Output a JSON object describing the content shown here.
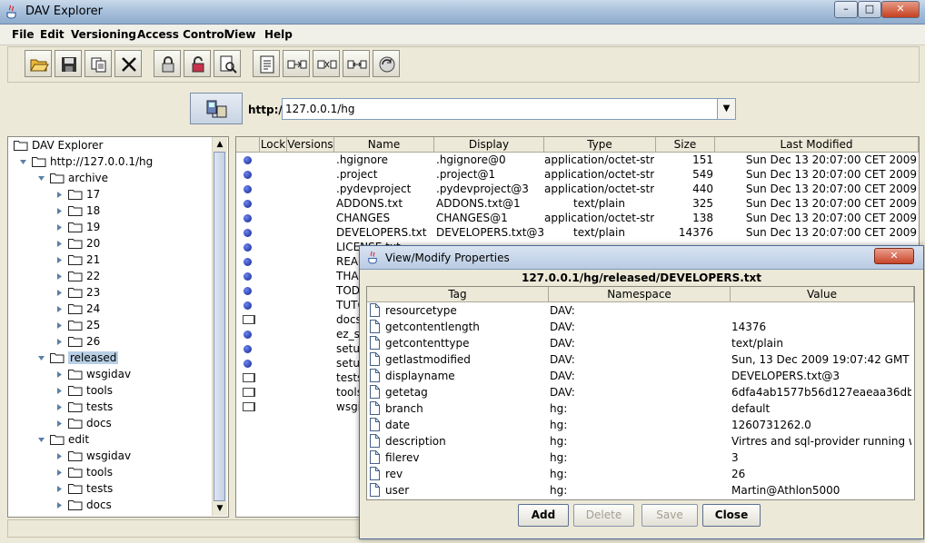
{
  "window": {
    "title": "DAV Explorer",
    "minimize": "–",
    "maximize": "□",
    "close": "✕"
  },
  "menubar": {
    "items": [
      "File",
      "Edit",
      "Versioning",
      "Access Control",
      "View",
      "Help"
    ]
  },
  "toolbar": {
    "buttons": [
      "open-folder-icon",
      "save-icon",
      "copy-icon",
      "delete-icon",
      "lock-icon",
      "unlock-icon",
      "preview-icon",
      "properties-icon",
      "put-icon",
      "move-icon",
      "sync-icon",
      "refresh-icon"
    ]
  },
  "url": {
    "prefix": "http://",
    "value": "127.0.0.1/hg",
    "dropdown": "▼"
  },
  "tree": {
    "nodes": [
      {
        "label": "DAV Explorer",
        "level": 0,
        "expander": "none"
      },
      {
        "label": "http://127.0.0.1/hg",
        "level": 1,
        "expander": "open"
      },
      {
        "label": "archive",
        "level": 2,
        "expander": "open"
      },
      {
        "label": "17",
        "level": 3,
        "expander": "closed"
      },
      {
        "label": "18",
        "level": 3,
        "expander": "closed"
      },
      {
        "label": "19",
        "level": 3,
        "expander": "closed"
      },
      {
        "label": "20",
        "level": 3,
        "expander": "closed"
      },
      {
        "label": "21",
        "level": 3,
        "expander": "closed"
      },
      {
        "label": "22",
        "level": 3,
        "expander": "closed"
      },
      {
        "label": "23",
        "level": 3,
        "expander": "closed"
      },
      {
        "label": "24",
        "level": 3,
        "expander": "closed"
      },
      {
        "label": "25",
        "level": 3,
        "expander": "closed"
      },
      {
        "label": "26",
        "level": 3,
        "expander": "closed"
      },
      {
        "label": "released",
        "level": 2,
        "expander": "open",
        "selected": true
      },
      {
        "label": "wsgidav",
        "level": 3,
        "expander": "closed"
      },
      {
        "label": "tools",
        "level": 3,
        "expander": "closed"
      },
      {
        "label": "tests",
        "level": 3,
        "expander": "closed"
      },
      {
        "label": "docs",
        "level": 3,
        "expander": "closed"
      },
      {
        "label": "edit",
        "level": 2,
        "expander": "open"
      },
      {
        "label": "wsgidav",
        "level": 3,
        "expander": "closed"
      },
      {
        "label": "tools",
        "level": 3,
        "expander": "closed"
      },
      {
        "label": "tests",
        "level": 3,
        "expander": "closed"
      },
      {
        "label": "docs",
        "level": 3,
        "expander": "closed"
      }
    ]
  },
  "grid": {
    "columns": [
      "Lock",
      "Versions",
      "Name",
      "Display",
      "Type",
      "Size",
      "Last Modified"
    ],
    "rows": [
      {
        "kind": "file",
        "name": ".hgignore",
        "display": ".hgignore@0",
        "type": "application/octet-str...",
        "size": "151",
        "modified": "Sun Dec 13 20:07:00 CET 2009"
      },
      {
        "kind": "file",
        "name": ".project",
        "display": ".project@1",
        "type": "application/octet-str...",
        "size": "549",
        "modified": "Sun Dec 13 20:07:00 CET 2009"
      },
      {
        "kind": "file",
        "name": ".pydevproject",
        "display": ".pydevproject@3",
        "type": "application/octet-str...",
        "size": "440",
        "modified": "Sun Dec 13 20:07:00 CET 2009"
      },
      {
        "kind": "file",
        "name": "ADDONS.txt",
        "display": "ADDONS.txt@1",
        "type": "text/plain",
        "size": "325",
        "modified": "Sun Dec 13 20:07:00 CET 2009"
      },
      {
        "kind": "file",
        "name": "CHANGES",
        "display": "CHANGES@1",
        "type": "application/octet-str...",
        "size": "138",
        "modified": "Sun Dec 13 20:07:00 CET 2009"
      },
      {
        "kind": "file",
        "name": "DEVELOPERS.txt",
        "display": "DEVELOPERS.txt@3",
        "type": "text/plain",
        "size": "14376",
        "modified": "Sun Dec 13 20:07:00 CET 2009"
      },
      {
        "kind": "file",
        "name": "LICENSE.txt",
        "display": "",
        "type": "",
        "size": "",
        "modified": ""
      },
      {
        "kind": "file",
        "name": "READ",
        "display": "",
        "type": "",
        "size": "",
        "modified": ""
      },
      {
        "kind": "file",
        "name": "THAN",
        "display": "",
        "type": "",
        "size": "",
        "modified": ""
      },
      {
        "kind": "file",
        "name": "TOD",
        "display": "",
        "type": "",
        "size": "",
        "modified": ""
      },
      {
        "kind": "file",
        "name": "TUTO",
        "display": "",
        "type": "",
        "size": "",
        "modified": ""
      },
      {
        "kind": "folder",
        "name": "docs",
        "display": "",
        "type": "",
        "size": "",
        "modified": ""
      },
      {
        "kind": "file",
        "name": "ez_s",
        "display": "",
        "type": "",
        "size": "",
        "modified": ""
      },
      {
        "kind": "file",
        "name": "setup",
        "display": "",
        "type": "",
        "size": "",
        "modified": ""
      },
      {
        "kind": "file",
        "name": "setup",
        "display": "",
        "type": "",
        "size": "",
        "modified": ""
      },
      {
        "kind": "folder",
        "name": "tests",
        "display": "",
        "type": "",
        "size": "",
        "modified": ""
      },
      {
        "kind": "folder",
        "name": "tools",
        "display": "",
        "type": "",
        "size": "",
        "modified": ""
      },
      {
        "kind": "folder",
        "name": "wsgi",
        "display": "",
        "type": "",
        "size": "",
        "modified": ""
      }
    ]
  },
  "dialog": {
    "title": "View/Modify Properties",
    "close": "✕",
    "path": "127.0.0.1/hg/released/DEVELOPERS.txt",
    "columns": [
      "Tag",
      "Namespace",
      "Value"
    ],
    "rows": [
      {
        "tag": "resourcetype",
        "ns": "DAV:",
        "value": ""
      },
      {
        "tag": "getcontentlength",
        "ns": "DAV:",
        "value": "14376"
      },
      {
        "tag": "getcontenttype",
        "ns": "DAV:",
        "value": "text/plain"
      },
      {
        "tag": "getlastmodified",
        "ns": "DAV:",
        "value": "Sun, 13 Dec 2009 19:07:42 GMT"
      },
      {
        "tag": "displayname",
        "ns": "DAV:",
        "value": "DEVELOPERS.txt@3"
      },
      {
        "tag": "getetag",
        "ns": "DAV:",
        "value": "6dfa4ab1577b56d127eaeaa36db..."
      },
      {
        "tag": "branch",
        "ns": "hg:",
        "value": "default"
      },
      {
        "tag": "date",
        "ns": "hg:",
        "value": "1260731262.0"
      },
      {
        "tag": "description",
        "ns": "hg:",
        "value": "Virtres and sql-provider running wi..."
      },
      {
        "tag": "filerev",
        "ns": "hg:",
        "value": "3"
      },
      {
        "tag": "rev",
        "ns": "hg:",
        "value": "26"
      },
      {
        "tag": "user",
        "ns": "hg:",
        "value": "Martin@Athlon5000"
      }
    ],
    "buttons": {
      "add": "Add",
      "delete": "Delete",
      "save": "Save",
      "close": "Close"
    }
  }
}
